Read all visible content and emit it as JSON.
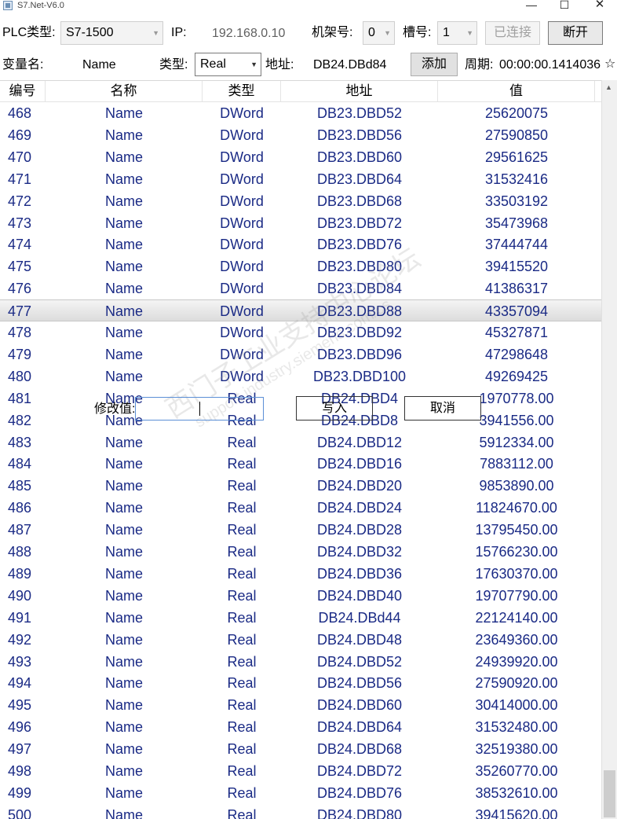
{
  "window": {
    "title": "S7.Net-V6.0",
    "min_glyph": "—",
    "max_glyph": "☐",
    "close_glyph": "✕"
  },
  "toolbar": {
    "plc_type_label": "PLC类型:",
    "plc_type_value": "S7-1500",
    "ip_label": "IP:",
    "ip_value": "192.168.0.10",
    "rack_label": "机架号:",
    "rack_value": "0",
    "slot_label": "槽号:",
    "slot_value": "1",
    "connected_label": "已连接",
    "disconnect_label": "断开",
    "var_name_label": "变量名:",
    "var_name_value": "Name",
    "type_label": "类型:",
    "type_value": "Real",
    "address_label": "地址:",
    "address_value": "DB24.DBd84",
    "add_label": "添加",
    "period_label": "周期:",
    "period_value": "00:00:00.1414036"
  },
  "grid": {
    "columns": [
      "编号",
      "名称",
      "类型",
      "地址",
      "值"
    ],
    "selected_id": "477",
    "rows": [
      [
        "468",
        "Name",
        "DWord",
        "DB23.DBD52",
        "25620075"
      ],
      [
        "469",
        "Name",
        "DWord",
        "DB23.DBD56",
        "27590850"
      ],
      [
        "470",
        "Name",
        "DWord",
        "DB23.DBD60",
        "29561625"
      ],
      [
        "471",
        "Name",
        "DWord",
        "DB23.DBD64",
        "31532416"
      ],
      [
        "472",
        "Name",
        "DWord",
        "DB23.DBD68",
        "33503192"
      ],
      [
        "473",
        "Name",
        "DWord",
        "DB23.DBD72",
        "35473968"
      ],
      [
        "474",
        "Name",
        "DWord",
        "DB23.DBD76",
        "37444744"
      ],
      [
        "475",
        "Name",
        "DWord",
        "DB23.DBD80",
        "39415520"
      ],
      [
        "476",
        "Name",
        "DWord",
        "DB23.DBD84",
        "41386317"
      ],
      [
        "477",
        "Name",
        "DWord",
        "DB23.DBD88",
        "43357094"
      ],
      [
        "478",
        "Name",
        "DWord",
        "DB23.DBD92",
        "45327871"
      ],
      [
        "479",
        "Name",
        "DWord",
        "DB23.DBD96",
        "47298648"
      ],
      [
        "480",
        "Name",
        "DWord",
        "DB23.DBD100",
        "49269425"
      ],
      [
        "481",
        "Name",
        "Real",
        "DB24.DBD4",
        "1970778.00"
      ],
      [
        "482",
        "Name",
        "Real",
        "DB24.DBD8",
        "3941556.00"
      ],
      [
        "483",
        "Name",
        "Real",
        "DB24.DBD12",
        "5912334.00"
      ],
      [
        "484",
        "Name",
        "Real",
        "DB24.DBD16",
        "7883112.00"
      ],
      [
        "485",
        "Name",
        "Real",
        "DB24.DBD20",
        "9853890.00"
      ],
      [
        "486",
        "Name",
        "Real",
        "DB24.DBD24",
        "11824670.00"
      ],
      [
        "487",
        "Name",
        "Real",
        "DB24.DBD28",
        "13795450.00"
      ],
      [
        "488",
        "Name",
        "Real",
        "DB24.DBD32",
        "15766230.00"
      ],
      [
        "489",
        "Name",
        "Real",
        "DB24.DBD36",
        "17630370.00"
      ],
      [
        "490",
        "Name",
        "Real",
        "DB24.DBD40",
        "19707790.00"
      ],
      [
        "491",
        "Name",
        "Real",
        "DB24.DBd44",
        "22124140.00"
      ],
      [
        "492",
        "Name",
        "Real",
        "DB24.DBD48",
        "23649360.00"
      ],
      [
        "493",
        "Name",
        "Real",
        "DB24.DBD52",
        "24939920.00"
      ],
      [
        "494",
        "Name",
        "Real",
        "DB24.DBD56",
        "27590920.00"
      ],
      [
        "495",
        "Name",
        "Real",
        "DB24.DBD60",
        "30414000.00"
      ],
      [
        "496",
        "Name",
        "Real",
        "DB24.DBD64",
        "31532480.00"
      ],
      [
        "497",
        "Name",
        "Real",
        "DB24.DBD68",
        "32519380.00"
      ],
      [
        "498",
        "Name",
        "Real",
        "DB24.DBD72",
        "35260770.00"
      ],
      [
        "499",
        "Name",
        "Real",
        "DB24.DBD76",
        "38532610.00"
      ],
      [
        "500",
        "Name",
        "Real",
        "DB24.DBD80",
        "39415620.00"
      ]
    ]
  },
  "edit": {
    "label": "修改值:",
    "value": "",
    "write_label": "写入",
    "cancel_label": "取消"
  },
  "watermark": {
    "line1": "西门子工业支持中心论坛",
    "line2": "support.industry.siemens.com/cs"
  }
}
